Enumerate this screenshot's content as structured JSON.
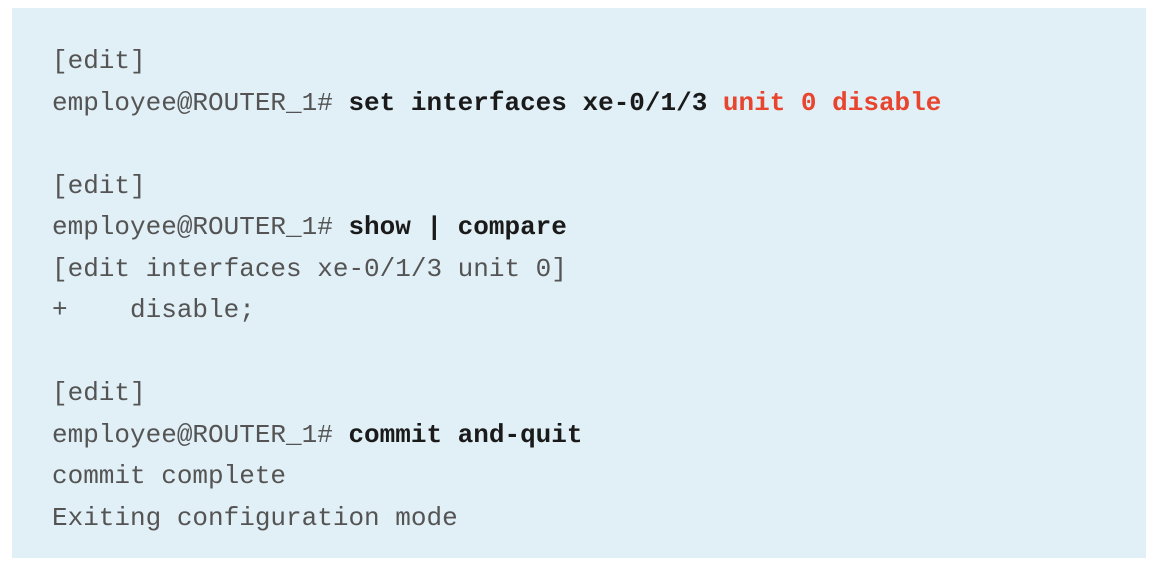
{
  "terminal": {
    "block1": {
      "context": "[edit]",
      "prompt": "employee@ROUTER_1# ",
      "command": "set interfaces xe-0/1/3 ",
      "command_highlight": "unit 0 disable"
    },
    "block2": {
      "context": "[edit]",
      "prompt": "employee@ROUTER_1# ",
      "command": "show | compare",
      "output_hierarchy": "[edit interfaces xe-0/1/3 unit 0]",
      "output_diff": "+    disable;"
    },
    "block3": {
      "context": "[edit]",
      "prompt": "employee@ROUTER_1# ",
      "command": "commit and-quit",
      "output_line1": "commit complete",
      "output_line2": "Exiting configuration mode"
    }
  },
  "colors": {
    "panel_background": "#e1eff6",
    "text": "#545454",
    "command": "#1a1a1a",
    "highlight": "#e8442e"
  }
}
